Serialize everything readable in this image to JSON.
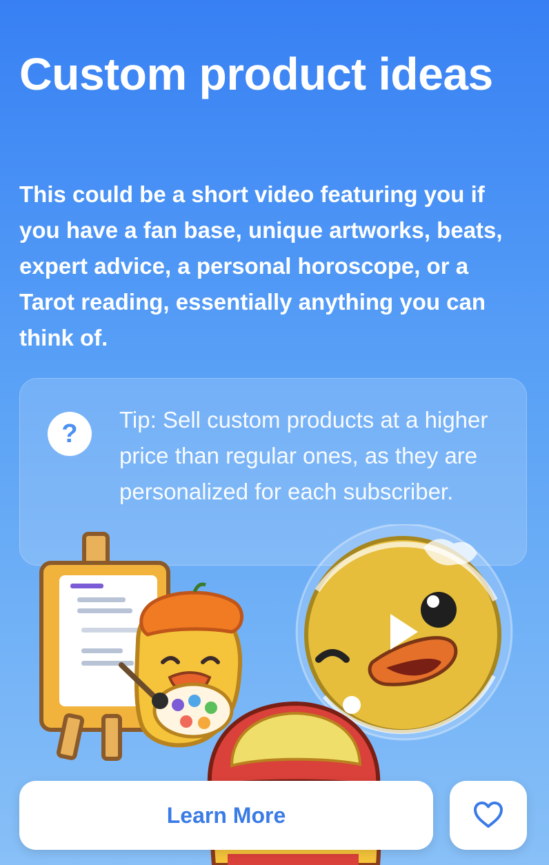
{
  "header": {
    "title": "Custom product ideas"
  },
  "intro": {
    "text": "This could be a short video featuring you if you have a fan base, unique artworks, beats, expert advice, a personal horoscope, or a Tarot reading, essentially anything you can think of."
  },
  "tip": {
    "icon": "question-icon",
    "text": "Tip: Sell custom products at a higher price than regular ones, as they are personalized for each subscriber."
  },
  "illustration": {
    "icons": [
      "easel-icon",
      "painter-duck-icon",
      "astronaut-duck-icon",
      "play-icon",
      "duck-with-cap-icon"
    ]
  },
  "actions": {
    "learn_more_label": "Learn More",
    "like_icon": "heart-icon"
  },
  "colors": {
    "background_top": "#3780f4",
    "background_bottom": "#88c0f7",
    "accent": "#3a7be6"
  }
}
